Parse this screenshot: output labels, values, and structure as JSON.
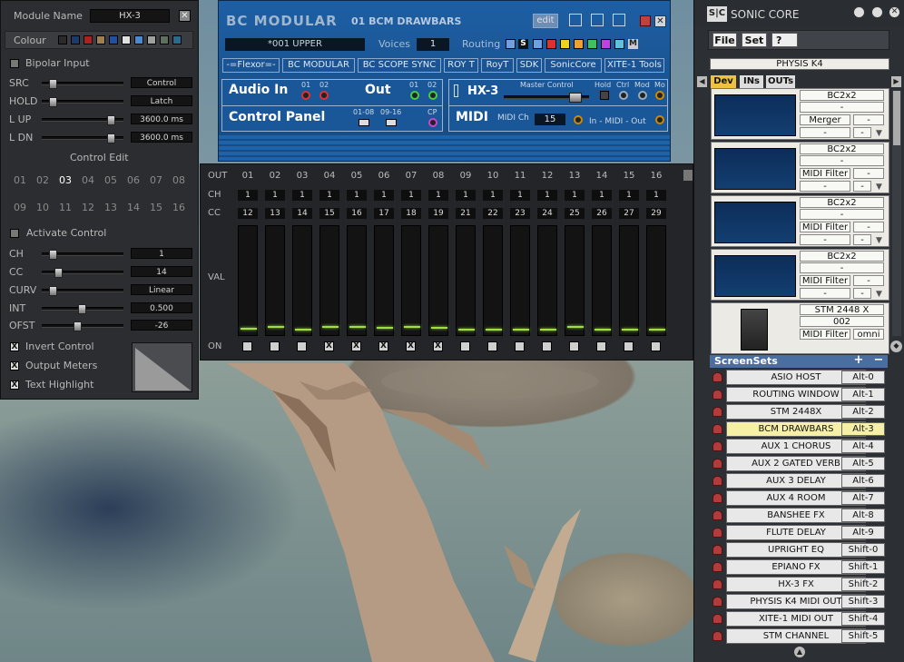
{
  "left_panel": {
    "module_name_label": "Module Name",
    "module_name_value": "HX-3",
    "colour_label": "Colour",
    "colour_swatches": [
      "#2b2b2b",
      "#1c3a6a",
      "#b02020",
      "#a08050",
      "#2050a0",
      "#e0e0e0",
      "#4a8ad0",
      "#a0a0a0",
      "#607060",
      "#2a6a8a"
    ],
    "bipolar_label": "Bipolar Input",
    "src_label": "SRC",
    "src_value": "Control",
    "hold_label": "HOLD",
    "hold_value": "Latch",
    "lup_label": "L UP",
    "lup_value": "3600.0 ms",
    "ldn_label": "L DN",
    "ldn_value": "3600.0 ms",
    "control_edit_label": "Control Edit",
    "control_numbers_row1": [
      "01",
      "02",
      "03",
      "04",
      "05",
      "06",
      "07",
      "08"
    ],
    "control_numbers_row2": [
      "09",
      "10",
      "11",
      "12",
      "13",
      "14",
      "15",
      "16"
    ],
    "activate_label": "Activate Control",
    "ch_label": "CH",
    "ch_value": "1",
    "cc_label": "CC",
    "cc_value": "14",
    "curv_label": "CURV",
    "curv_value": "Linear",
    "int_label": "INT",
    "int_value": "0.500",
    "ofst_label": "OFST",
    "ofst_value": "-26",
    "invert_label": "Invert Control",
    "output_meters_label": "Output Meters",
    "text_highlight_label": "Text Highlight",
    "check_mark": "X"
  },
  "bc_modular": {
    "title": "BC MODULAR",
    "preset_title": "01 BCM DRAWBARS",
    "edit_label": "edit",
    "patch_name": "*001 UPPER",
    "voices_label": "Voices",
    "voices_value": "1",
    "routing_label": "Routing",
    "routing_s": "S",
    "routing_m": "M",
    "routing_colors": [
      "#6fa0e0",
      "#e03030",
      "#f0d020",
      "#f0a030",
      "#40c060",
      "#c040e0",
      "#60c0e0"
    ],
    "links": [
      "-=Flexor=-",
      "BC MODULAR",
      "BC SCOPE SYNC",
      "ROY T",
      "RoyT",
      "SDK",
      "SonicCore",
      "XITE-1 Tools"
    ],
    "audio_in_label": "Audio In",
    "audio_in_01": "01",
    "audio_in_02": "02",
    "out_label": "Out",
    "out_01": "01",
    "out_02": "02",
    "control_panel_label": "Control Panel",
    "cp_range1": "01-08",
    "cp_range2": "09-16",
    "cp_label": "CP",
    "module_name": "HX-3",
    "master_control_label": "Master Control",
    "hold_label": "Hold",
    "ctrl_label": "Ctrl",
    "mod_label": "Mod",
    "mo_label": "Mo",
    "midi_label": "MIDI",
    "midi_ch_label": "MIDI Ch",
    "midi_ch_value": "15",
    "midi_inout_label": "In - MIDI - Out"
  },
  "grid": {
    "out_label": "OUT",
    "ch_label": "CH",
    "cc_label": "CC",
    "val_label": "VAL",
    "on_label": "ON",
    "columns": [
      "01",
      "02",
      "03",
      "04",
      "05",
      "06",
      "07",
      "08",
      "09",
      "10",
      "11",
      "12",
      "13",
      "14",
      "15",
      "16"
    ],
    "ch_values": [
      "1",
      "1",
      "1",
      "1",
      "1",
      "1",
      "1",
      "1",
      "1",
      "1",
      "1",
      "1",
      "1",
      "1",
      "1",
      "1"
    ],
    "cc_values": [
      "12",
      "13",
      "14",
      "15",
      "16",
      "17",
      "18",
      "19",
      "21",
      "22",
      "23",
      "24",
      "25",
      "26",
      "27",
      "29"
    ],
    "levels": [
      0.05,
      0.07,
      0.04,
      0.07,
      0.07,
      0.06,
      0.07,
      0.06,
      0.04,
      0.04,
      0.04,
      0.04,
      0.07,
      0.04,
      0.04,
      0.04
    ],
    "on_states": [
      false,
      false,
      false,
      true,
      true,
      true,
      true,
      true,
      false,
      false,
      false,
      false,
      false,
      false,
      false,
      false
    ],
    "on_mark": "X"
  },
  "sonic_core": {
    "title": "SONIC CORE",
    "logo": "S|C",
    "menu": [
      "File",
      "Set",
      "?"
    ],
    "device_name": "PHYSIS K4",
    "tabs": [
      "Dev",
      "INs",
      "OUTs"
    ],
    "devices": [
      {
        "name": "BC2x2",
        "f1": "-",
        "f2": "Merger",
        "f3": "-",
        "f4": "-",
        "f5": "-"
      },
      {
        "name": "BC2x2",
        "f1": "-",
        "f2": "MIDI Filter",
        "f3": "-",
        "f4": "-",
        "f5": "-"
      },
      {
        "name": "BC2x2",
        "f1": "-",
        "f2": "MIDI Filter",
        "f3": "-",
        "f4": "-",
        "f5": "-"
      },
      {
        "name": "BC2x2",
        "f1": "-",
        "f2": "MIDI Filter",
        "f3": "-",
        "f4": "-",
        "f5": "-"
      },
      {
        "name": "STM 2448 X",
        "f1": "002",
        "f2": "MIDI Filter",
        "f3": "omni",
        "f4": "",
        "f5": ""
      }
    ],
    "screensets_label": "ScreenSets",
    "screensets": [
      {
        "name": "ASIO HOST",
        "key": "Alt-0"
      },
      {
        "name": "ROUTING WINDOW",
        "key": "Alt-1"
      },
      {
        "name": "STM 2448X",
        "key": "Alt-2"
      },
      {
        "name": "BCM DRAWBARS",
        "key": "Alt-3"
      },
      {
        "name": "AUX 1 CHORUS",
        "key": "Alt-4"
      },
      {
        "name": "AUX 2 GATED VERB",
        "key": "Alt-5"
      },
      {
        "name": "AUX 3 DELAY",
        "key": "Alt-6"
      },
      {
        "name": "AUX 4 ROOM",
        "key": "Alt-7"
      },
      {
        "name": "BANSHEE FX",
        "key": "Alt-8"
      },
      {
        "name": "FLUTE DELAY",
        "key": "Alt-9"
      },
      {
        "name": "UPRIGHT EQ",
        "key": "Shift-0"
      },
      {
        "name": "EPIANO FX",
        "key": "Shift-1"
      },
      {
        "name": "HX-3 FX",
        "key": "Shift-2"
      },
      {
        "name": "PHYSIS K4 MIDI OUT",
        "key": "Shift-3"
      },
      {
        "name": "XITE-1 MIDI OUT",
        "key": "Shift-4"
      },
      {
        "name": "STM CHANNEL",
        "key": "Shift-5"
      }
    ],
    "active_screenset": 3
  }
}
